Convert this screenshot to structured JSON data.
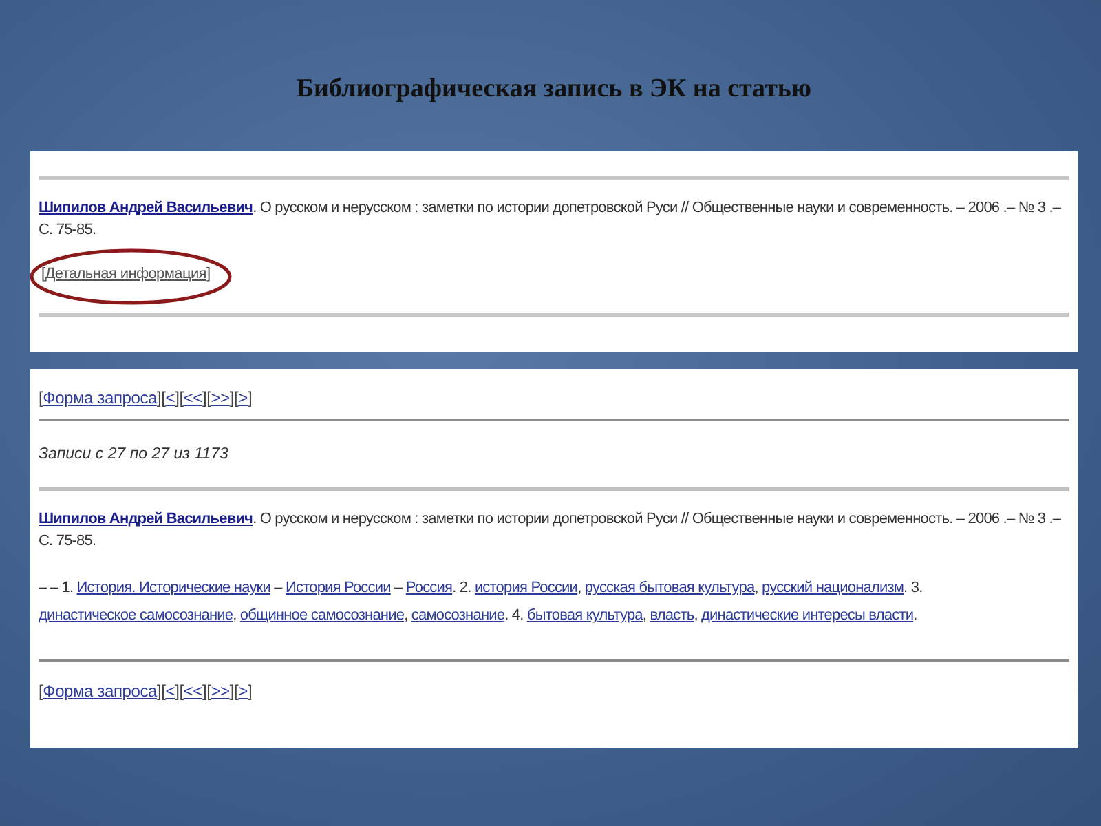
{
  "slide_title": "Библиографическая запись в ЭК на статью",
  "top_panel": {
    "record": {
      "author": "Шипилов Андрей Васильевич",
      "description": ". О русском и нерусском : заметки по истории допетровской Руси // Общественные науки и современность. – 2006 .– № 3 .– С. 75-85."
    },
    "detail_link": {
      "open": "[",
      "label": "Детальная информация",
      "close": "]",
      "circled": true
    }
  },
  "bottom_panel": {
    "nav_top": [
      {
        "kind": "text",
        "text": "["
      },
      {
        "kind": "link",
        "text": "Форма запроса"
      },
      {
        "kind": "text",
        "text": "]["
      },
      {
        "kind": "link",
        "text": "<"
      },
      {
        "kind": "text",
        "text": "]["
      },
      {
        "kind": "link",
        "text": "<<"
      },
      {
        "kind": "text",
        "text": "]["
      },
      {
        "kind": "link",
        "text": ">>"
      },
      {
        "kind": "text",
        "text": "]["
      },
      {
        "kind": "link",
        "text": ">"
      },
      {
        "kind": "text",
        "text": "]"
      }
    ],
    "records_count": "Записи с 27 по 27 из 1173",
    "record": {
      "author": "Шипилов Андрей Васильевич",
      "description": ". О русском и нерусском : заметки по истории допетровской Руси // Общественные науки и современность. – 2006 .– № 3 .– С. 75-85."
    },
    "subjects": [
      {
        "kind": "text",
        "text": "– – 1. "
      },
      {
        "kind": "link",
        "text": "История. Исторические науки"
      },
      {
        "kind": "text",
        "text": " – "
      },
      {
        "kind": "link",
        "text": "История России"
      },
      {
        "kind": "text",
        "text": " – "
      },
      {
        "kind": "link",
        "text": "Россия"
      },
      {
        "kind": "text",
        "text": ". 2. "
      },
      {
        "kind": "link",
        "text": "история России"
      },
      {
        "kind": "text",
        "text": ", "
      },
      {
        "kind": "link",
        "text": "русская бытовая культура"
      },
      {
        "kind": "text",
        "text": ", "
      },
      {
        "kind": "link",
        "text": "русский национализм"
      },
      {
        "kind": "text",
        "text": ". 3. "
      },
      {
        "kind": "link",
        "text": "династическое самосознание"
      },
      {
        "kind": "text",
        "text": ", "
      },
      {
        "kind": "link",
        "text": "общинное самосознание"
      },
      {
        "kind": "text",
        "text": ", "
      },
      {
        "kind": "link",
        "text": "самосознание"
      },
      {
        "kind": "text",
        "text": ". 4. "
      },
      {
        "kind": "link",
        "text": "бытовая культура"
      },
      {
        "kind": "text",
        "text": ", "
      },
      {
        "kind": "link",
        "text": "власть"
      },
      {
        "kind": "text",
        "text": ", "
      },
      {
        "kind": "link",
        "text": "династические интересы власти"
      },
      {
        "kind": "text",
        "text": "."
      }
    ],
    "nav_bottom": [
      {
        "kind": "text",
        "text": "["
      },
      {
        "kind": "link",
        "text": "Форма запроса"
      },
      {
        "kind": "text",
        "text": "]["
      },
      {
        "kind": "link",
        "text": "<"
      },
      {
        "kind": "text",
        "text": "]["
      },
      {
        "kind": "link",
        "text": "<<"
      },
      {
        "kind": "text",
        "text": "]["
      },
      {
        "kind": "link",
        "text": ">>"
      },
      {
        "kind": "text",
        "text": "]["
      },
      {
        "kind": "link",
        "text": ">"
      },
      {
        "kind": "text",
        "text": "]"
      }
    ]
  }
}
